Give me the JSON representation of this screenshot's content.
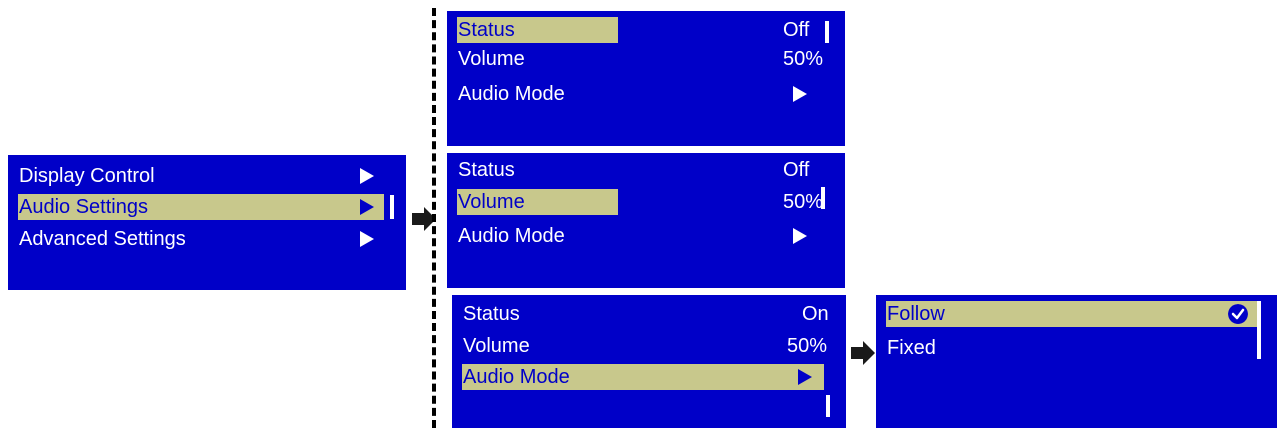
{
  "main_menu": {
    "items": [
      {
        "label": "Display Control"
      },
      {
        "label": "Audio Settings"
      },
      {
        "label": "Advanced Settings"
      }
    ]
  },
  "audio_panel_1": {
    "status_label": "Status",
    "status_value": "Off",
    "volume_label": "Volume",
    "volume_value": "50%",
    "audio_mode_label": "Audio Mode"
  },
  "audio_panel_2": {
    "status_label": "Status",
    "status_value": "Off",
    "volume_label": "Volume",
    "volume_value": "50%",
    "audio_mode_label": "Audio Mode"
  },
  "audio_panel_3": {
    "status_label": "Status",
    "status_value": "On",
    "volume_label": "Volume",
    "volume_value": "50%",
    "audio_mode_label": "Audio Mode"
  },
  "audio_mode_panel": {
    "options": [
      {
        "label": "Follow",
        "checked": true
      },
      {
        "label": "Fixed",
        "checked": false
      }
    ]
  },
  "colors": {
    "panel_bg": "#0000c8",
    "highlight": "#c8c88c",
    "text": "#ffffff"
  },
  "icons": {
    "submenu": "triangle-right-icon",
    "step_arrow": "arrow-right-icon",
    "checked": "check-circle-icon"
  }
}
